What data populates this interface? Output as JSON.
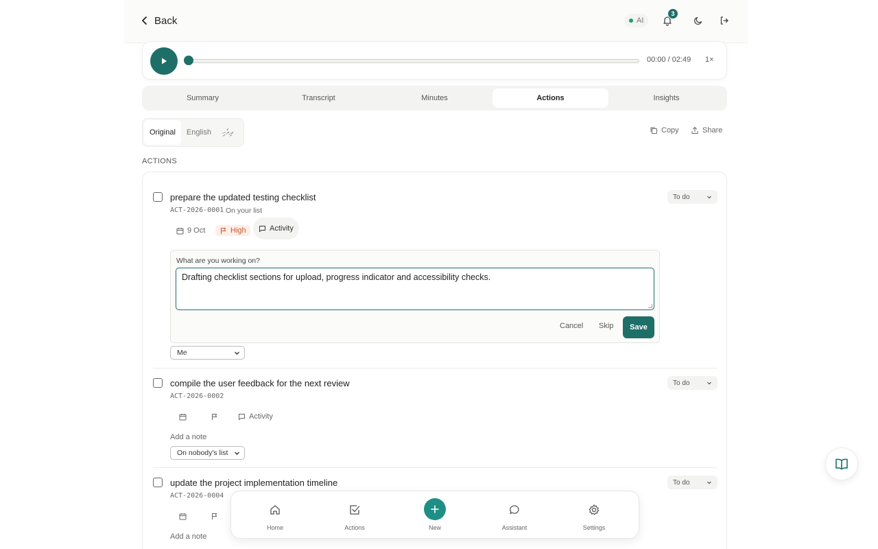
{
  "header": {
    "back_label": "Back",
    "ai_label": "AI",
    "notification_count": "3"
  },
  "player": {
    "time": "00:00 / 02:49",
    "speed": "1×",
    "progress": 0
  },
  "tabs": [
    {
      "label": "Summary",
      "active": false
    },
    {
      "label": "Transcript",
      "active": false
    },
    {
      "label": "Minutes",
      "active": false
    },
    {
      "label": "Actions",
      "active": true
    },
    {
      "label": "Insights",
      "active": false
    }
  ],
  "language": {
    "options": [
      "Original",
      "English",
      "ދިވެހި"
    ],
    "selected": "Original"
  },
  "toolbar": {
    "copy_label": "Copy",
    "share_label": "Share"
  },
  "section_label": "ACTIONS",
  "actions": [
    {
      "title": "prepare the updated testing checklist",
      "code": "ACT-2026-0001",
      "owner_text": "On your list",
      "status": "To do",
      "date": "9 Oct",
      "priority": "High",
      "activity_label": "Activity",
      "note_prompt": "What are you working on?",
      "note_text": "Drafting checklist sections for upload, progress indicator and accessibility checks.",
      "cancel_label": "Cancel",
      "skip_label": "Skip",
      "save_label": "Save",
      "assignee": "Me"
    },
    {
      "title": "compile the user feedback for the next review",
      "code": "ACT-2026-0002",
      "status": "To do",
      "activity_label": "Activity",
      "add_note": "Add a note",
      "assignee": "On nobody's list"
    },
    {
      "title": "update the project implementation timeline",
      "code": "ACT-2026-0004",
      "status": "To do",
      "add_note": "Add a note"
    }
  ],
  "bottom_nav": [
    {
      "label": "Home",
      "icon": "home-icon"
    },
    {
      "label": "Actions",
      "icon": "check-square-icon"
    },
    {
      "label": "New",
      "icon": "plus-icon"
    },
    {
      "label": "Assistant",
      "icon": "chat-icon"
    },
    {
      "label": "Settings",
      "icon": "gear-icon"
    }
  ],
  "colors": {
    "accent": "#1e6f68",
    "priority_high": "#c85a2a"
  }
}
